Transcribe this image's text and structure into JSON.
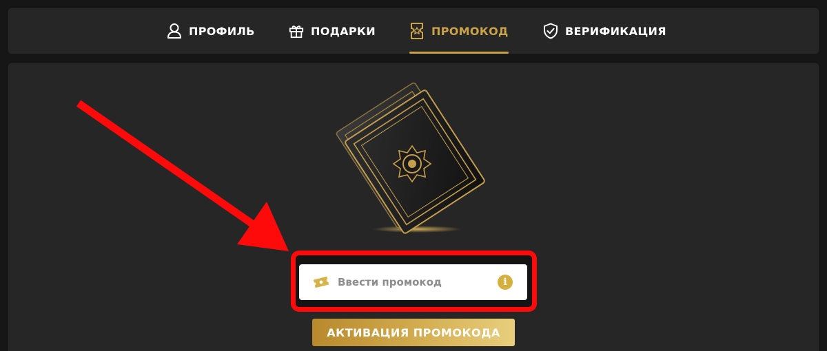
{
  "nav": {
    "tabs": [
      {
        "label": "ПРОФИЛЬ",
        "icon": "user-icon"
      },
      {
        "label": "ПОДАРКИ",
        "icon": "gift-icon"
      },
      {
        "label": "ПРОМОКОД",
        "icon": "ticket-icon",
        "active": true
      },
      {
        "label": "ВЕРИФИКАЦИЯ",
        "icon": "shield-check-icon"
      }
    ]
  },
  "promo": {
    "placeholder": "Ввести промокод",
    "value": "",
    "info_icon_text": "i",
    "activate_label": "АКТИВАЦИЯ ПРОМОКОДА"
  },
  "colors": {
    "accent_gold": "#c9a24a",
    "annotation_red": "#ff0a0a",
    "background": "#161616",
    "panel": "#262626"
  }
}
